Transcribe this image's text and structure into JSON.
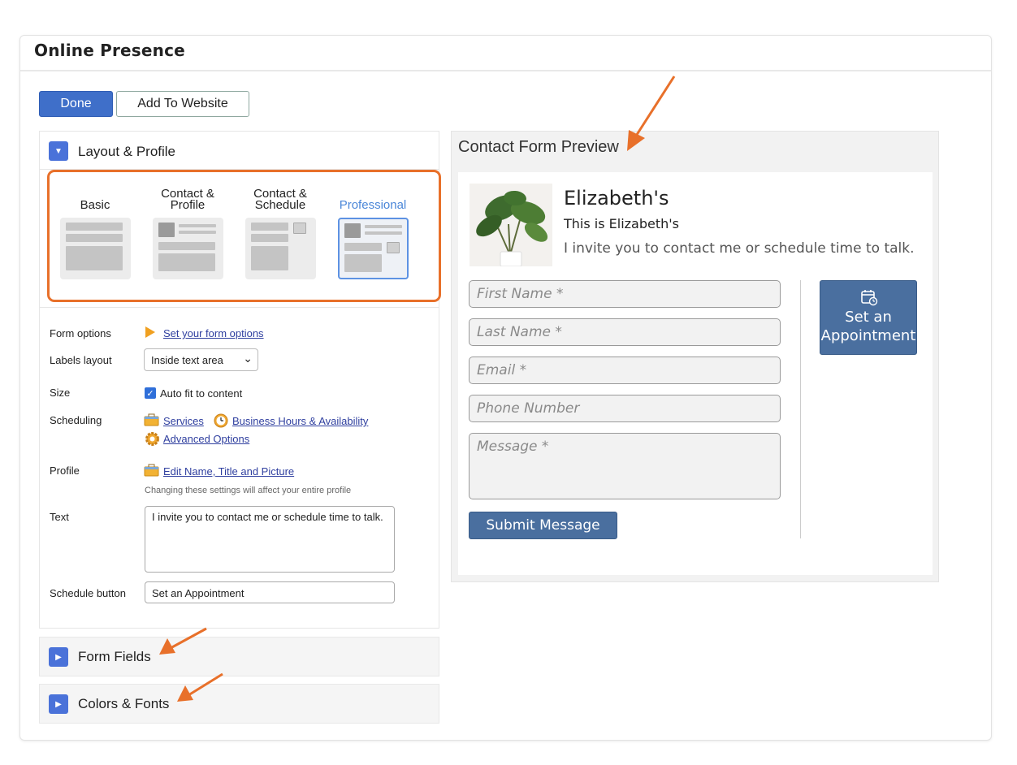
{
  "panel": {
    "title": "Online Presence"
  },
  "toolbar": {
    "done_label": "Done",
    "add_label": "Add To Website"
  },
  "layout_section": {
    "title": "Layout & Profile",
    "options": [
      {
        "name": "Basic"
      },
      {
        "name": "Contact &\nProfile"
      },
      {
        "name": "Contact &\nSchedule"
      },
      {
        "name": "Professional",
        "selected": true
      }
    ]
  },
  "settings": {
    "form_options_label": "Form options",
    "form_options_link": "Set your form options",
    "labels_layout_label": "Labels layout",
    "labels_layout_value": "Inside text area",
    "size_label": "Size",
    "auto_fit_label": "Auto fit to content",
    "auto_fit_checked": true,
    "scheduling_label": "Scheduling",
    "services_link": "Services",
    "business_hours_link": "Business Hours & Availability",
    "advanced_link": "Advanced Options",
    "profile_label": "Profile",
    "profile_link": "Edit Name, Title and Picture",
    "profile_hint": "Changing these settings will affect your entire profile",
    "text_label": "Text",
    "text_value": "I invite you to contact me or schedule time to talk.",
    "schedule_button_label": "Schedule button",
    "schedule_button_value": "Set an Appointment"
  },
  "form_fields_section": {
    "title": "Form Fields"
  },
  "colors_section": {
    "title": "Colors & Fonts"
  },
  "preview": {
    "title": "Contact Form Preview",
    "name": "Elizabeth's",
    "subtitle": "This is Elizabeth's",
    "message": "I invite you to contact me or schedule time to talk.",
    "fields": {
      "first_name": "First Name *",
      "last_name": "Last Name *",
      "email": "Email *",
      "phone": "Phone Number",
      "message": "Message *"
    },
    "submit_label": "Submit Message",
    "appointment_line1": "Set an",
    "appointment_line2": "Appointment"
  },
  "colors": {
    "accent": "#3f6fc9",
    "highlight": "#e8702a",
    "preview_button": "#4a6f9f"
  }
}
